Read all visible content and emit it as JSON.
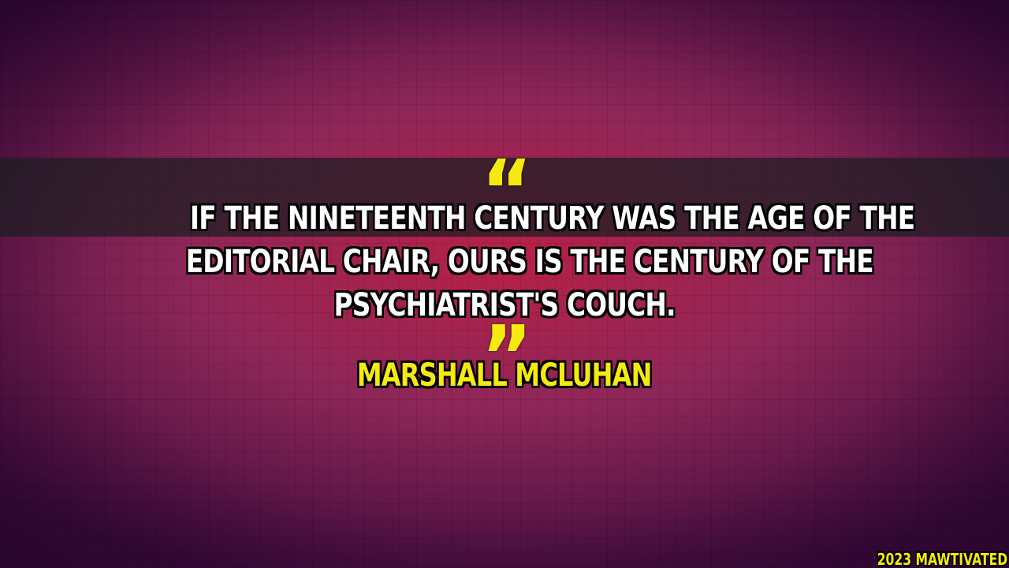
{
  "quote": {
    "open_mark": "“",
    "close_mark": "”",
    "lines": [
      "IF THE NINETEENTH CENTURY WAS THE AGE OF THE",
      "EDITORIAL CHAIR, OURS IS THE CENTURY OF THE",
      "PSYCHIATRIST'S COUCH."
    ]
  },
  "author": "MARSHALL MCLUHAN",
  "watermark": "2023 MAWTIVATED",
  "colors": {
    "accent_yellow": "#f5ea10",
    "text_white": "#ffffff",
    "band": "#1e1e23",
    "background_center": "#b4143c",
    "background_edge": "#3c0a3c"
  }
}
